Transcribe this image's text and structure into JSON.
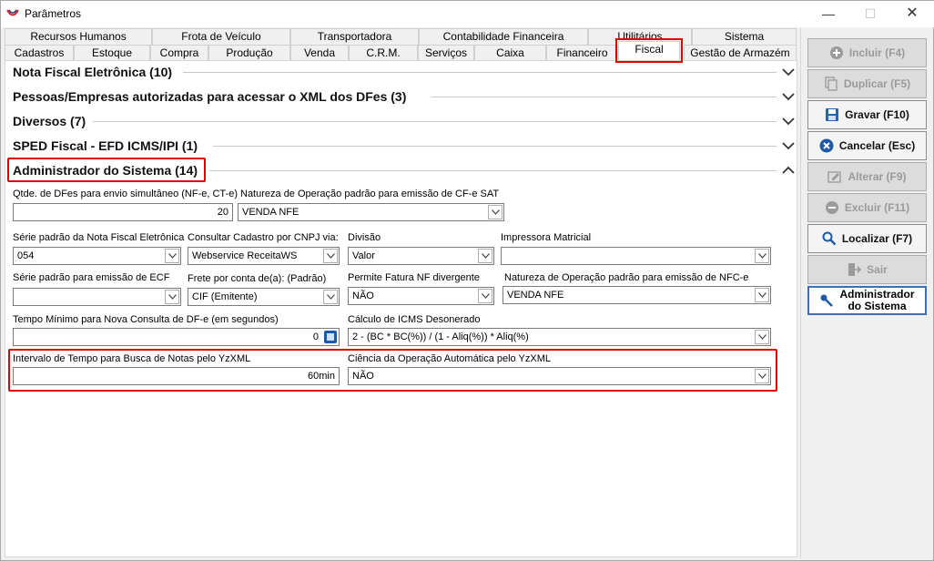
{
  "window": {
    "title": "Parâmetros",
    "minimize": "—",
    "maximize": "☐",
    "close": "✕"
  },
  "tabs_row1": [
    "Recursos Humanos",
    "Frota de Veículo",
    "Transportadora",
    "Contabilidade Financeira",
    "Utilitários",
    "Sistema"
  ],
  "tabs_row2": [
    "Cadastros",
    "Estoque",
    "Compra",
    "Produção",
    "Venda",
    "C.R.M.",
    "Serviços",
    "Caixa",
    "Financeiro",
    "Fiscal",
    "Gestão de Armazém"
  ],
  "groups": [
    {
      "title": "Nota Fiscal Eletrônica (10)"
    },
    {
      "title": "Pessoas/Empresas autorizadas para acessar o XML dos DFes (3)"
    },
    {
      "title": "Diversos (7)"
    },
    {
      "title": "SPED Fiscal - EFD ICMS/IPI (1)"
    },
    {
      "title": "Administrador do Sistema (14)"
    }
  ],
  "fields": {
    "qtde_dfes": {
      "label": "Qtde. de DFes para envio simultâneo (NF-e, CT-e)",
      "value": "20"
    },
    "natureza_cfe": {
      "label": "Natureza de Operação padrão para emissão de CF-e SAT",
      "value": "VENDA NFE"
    },
    "serie_nfe": {
      "label": "Série padrão da Nota Fiscal Eletrônica",
      "value": "054"
    },
    "consultar_cnpj": {
      "label": "Consultar Cadastro por CNPJ via:",
      "value": "Webservice ReceitaWS"
    },
    "divisao": {
      "label": "Divisão",
      "value": "Valor"
    },
    "impressora": {
      "label": "Impressora Matricial",
      "value": ""
    },
    "serie_ecf": {
      "label": "Série padrão para emissão de ECF",
      "value": ""
    },
    "frete": {
      "label": "Frete por conta de(a): (Padrão)",
      "value": "CIF (Emitente)"
    },
    "fatura_nf": {
      "label": "Permite Fatura NF divergente",
      "value": "NÃO"
    },
    "natureza_nfce": {
      "label": "Natureza de Operação padrão para emissão de NFC-e",
      "value": "VENDA NFE"
    },
    "tempo_consulta": {
      "label": "Tempo Mínimo para Nova Consulta de DF-e (em segundos)",
      "value": "0"
    },
    "calculo_icms": {
      "label": "Cálculo de ICMS Desonerado",
      "value": "2 - (BC * BC(%)) / (1 - Aliq(%)) * Aliq(%)"
    },
    "intervalo_yzxml": {
      "label": "Intervalo de Tempo para Busca de Notas pelo YzXML",
      "value": "60min"
    },
    "ciencia_yzxml": {
      "label": "Ciência da Operação Automática pelo YzXML",
      "value": "NÃO"
    }
  },
  "buttons": {
    "incluir": "Incluir (F4)",
    "duplicar": "Duplicar (F5)",
    "gravar": "Gravar (F10)",
    "cancelar": "Cancelar (Esc)",
    "alterar": "Alterar (F9)",
    "excluir": "Excluir (F11)",
    "localizar": "Localizar (F7)",
    "sair": "Sair",
    "admin_line1": "Administrador",
    "admin_line2": "do Sistema"
  },
  "colors": {
    "highlight": "#e00000",
    "accent": "#1a5aa8"
  }
}
